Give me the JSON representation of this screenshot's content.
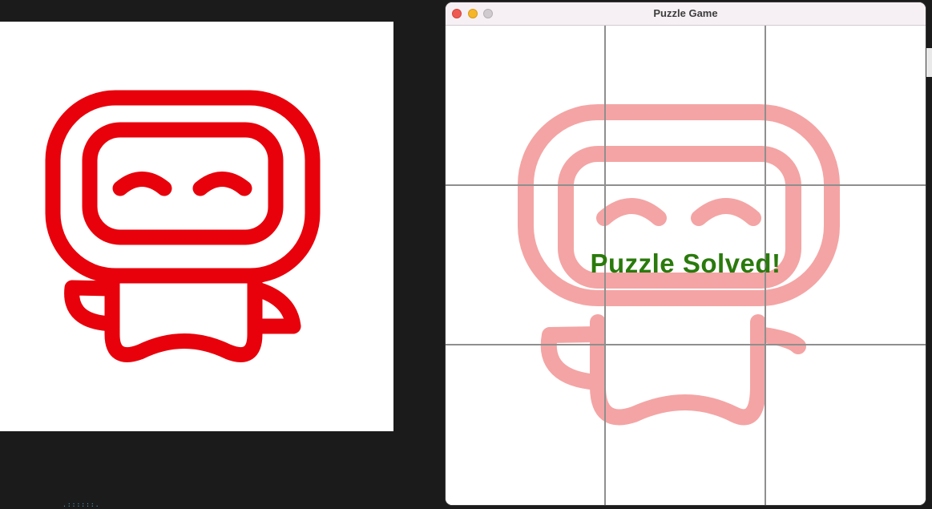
{
  "window": {
    "title": "Puzzle Game"
  },
  "board": {
    "rows": 3,
    "columns": 3,
    "status_text": "Puzzle Solved!",
    "status_color": "#2a7a0c",
    "tiles": [
      {
        "position": 1
      },
      {
        "position": 2
      },
      {
        "position": 3
      },
      {
        "position": 4
      },
      {
        "position": 5
      },
      {
        "position": 6
      },
      {
        "position": 7
      },
      {
        "position": 8
      },
      {
        "position": 9
      }
    ]
  },
  "image": {
    "subject": "robot-mascot",
    "color": "#e8000b",
    "faded_color": "#f4a4a4"
  },
  "colors": {
    "desktop_background": "#1b1b1b",
    "grid_lines": "#8f8f8f",
    "titlebar": "#f6f0f4"
  }
}
